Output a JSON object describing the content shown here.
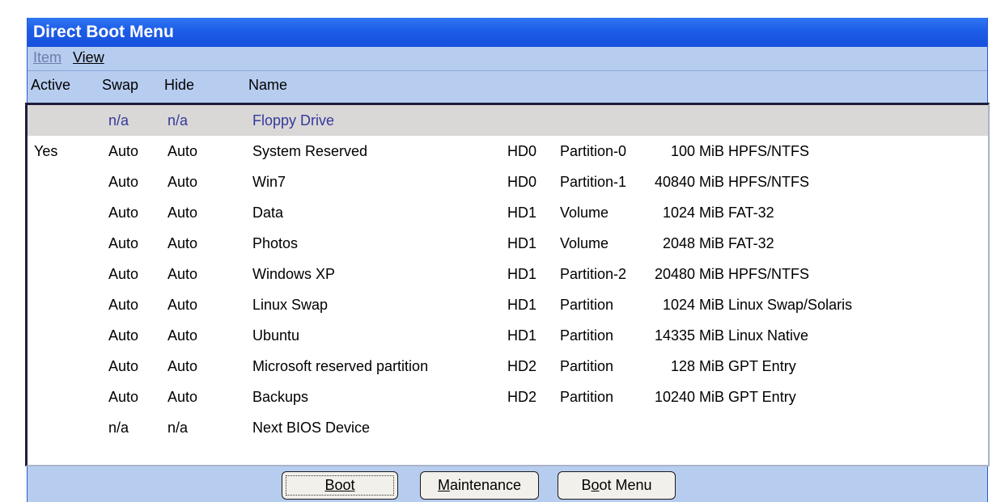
{
  "window": {
    "title": "Direct Boot Menu"
  },
  "menubar": {
    "items": [
      {
        "label": "Item",
        "enabled": false
      },
      {
        "label": "View",
        "enabled": true
      }
    ]
  },
  "columns": {
    "active": "Active",
    "swap": "Swap",
    "hide": "Hide",
    "name": "Name"
  },
  "rows": [
    {
      "active": "",
      "swap": "n/a",
      "hide": "n/a",
      "name": "Floppy Drive",
      "disk": "",
      "partition": "",
      "size": "",
      "fs": "",
      "selected": true
    },
    {
      "active": "Yes",
      "swap": "Auto",
      "hide": "Auto",
      "name": "System Reserved",
      "disk": "HD0",
      "partition": "Partition-0",
      "size": "100 MiB",
      "fs": "HPFS/NTFS"
    },
    {
      "active": "",
      "swap": "Auto",
      "hide": "Auto",
      "name": "Win7",
      "disk": "HD0",
      "partition": "Partition-1",
      "size": "40840 MiB",
      "fs": "HPFS/NTFS"
    },
    {
      "active": "",
      "swap": "Auto",
      "hide": "Auto",
      "name": "Data",
      "disk": "HD1",
      "partition": "Volume",
      "size": "1024 MiB",
      "fs": "FAT-32"
    },
    {
      "active": "",
      "swap": "Auto",
      "hide": "Auto",
      "name": "Photos",
      "disk": "HD1",
      "partition": "Volume",
      "size": "2048 MiB",
      "fs": "FAT-32"
    },
    {
      "active": "",
      "swap": "Auto",
      "hide": "Auto",
      "name": "Windows XP",
      "disk": "HD1",
      "partition": "Partition-2",
      "size": "20480 MiB",
      "fs": "HPFS/NTFS"
    },
    {
      "active": "",
      "swap": "Auto",
      "hide": "Auto",
      "name": "Linux Swap",
      "disk": "HD1",
      "partition": "Partition",
      "size": "1024 MiB",
      "fs": "Linux Swap/Solaris"
    },
    {
      "active": "",
      "swap": "Auto",
      "hide": "Auto",
      "name": "Ubuntu",
      "disk": "HD1",
      "partition": "Partition",
      "size": "14335 MiB",
      "fs": "Linux Native"
    },
    {
      "active": "",
      "swap": "Auto",
      "hide": "Auto",
      "name": "Microsoft reserved partition",
      "disk": "HD2",
      "partition": "Partition",
      "size": "128 MiB",
      "fs": "GPT Entry"
    },
    {
      "active": "",
      "swap": "Auto",
      "hide": "Auto",
      "name": "Backups",
      "disk": "HD2",
      "partition": "Partition",
      "size": "10240 MiB",
      "fs": "GPT Entry"
    },
    {
      "active": "",
      "swap": "n/a",
      "hide": "n/a",
      "name": "Next BIOS Device",
      "disk": "",
      "partition": "",
      "size": "",
      "fs": ""
    }
  ],
  "buttons": {
    "boot": "Boot",
    "maintenance": "Maintenance",
    "boot_menu": "Boot Menu"
  },
  "colors": {
    "titlebar": "#1d5ce6",
    "window_bg": "#b7cdf0",
    "selected_row_bg": "#dad7d7",
    "selected_row_text": "#343a9a"
  }
}
